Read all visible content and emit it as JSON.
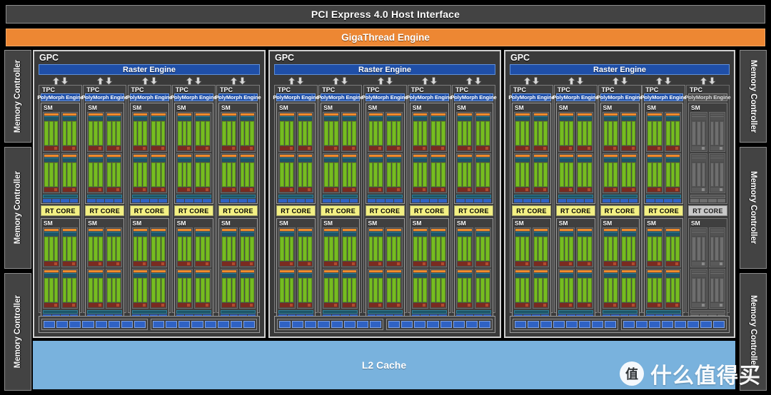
{
  "diagram": {
    "host_interface": "PCI Express 4.0 Host Interface",
    "gigathread_engine": "GigaThread Engine",
    "l2_cache": "L2 Cache",
    "gpc_label": "GPC",
    "raster_engine_label": "Raster Engine",
    "tpc_label": "TPC",
    "polymorph_label": "PolyMorph Engine",
    "sm_label": "SM",
    "rt_core_label": "RT CORE",
    "memory_controller_label": "Memory Controller"
  },
  "colors": {
    "background": "#000000",
    "panel": "#434343",
    "gpc_fill": "#3a3a3a",
    "gigathread": "#ed8733",
    "raster_blue": "#1f4fa8",
    "core_green": "#76bc21",
    "rt_core_yellow": "#f3f083",
    "l2_blue": "#79b2dd",
    "rop_blue": "#2f62c4",
    "teal": "#1d5566",
    "orange_bar": "#ef8a2b",
    "dark_red": "#7a2b20",
    "disabled_grey": "#6e6e6e"
  },
  "structure": {
    "gpc_count": 3,
    "tpc_per_gpc": 5,
    "sm_per_tpc": 2,
    "quads_per_sm": 4,
    "cores_per_quad": 3,
    "rop_groups_per_gpc": 2,
    "rops_per_group": 8,
    "memory_controllers_per_side": 3,
    "disabled_tpc_location": "gpc-3-tpc-5"
  },
  "memory_controllers": {
    "left": [
      "Memory Controller",
      "Memory Controller",
      "Memory Controller"
    ],
    "right": [
      "Memory Controller",
      "Memory Controller",
      "Memory Controller"
    ]
  },
  "gpcs": [
    {
      "label": "GPC",
      "raster": "Raster Engine",
      "tpcs": [
        {
          "label": "TPC",
          "polymorph": "PolyMorph Engine",
          "disabled": false
        },
        {
          "label": "TPC",
          "polymorph": "PolyMorph Engine",
          "disabled": false
        },
        {
          "label": "TPC",
          "polymorph": "PolyMorph Engine",
          "disabled": false
        },
        {
          "label": "TPC",
          "polymorph": "PolyMorph Engine",
          "disabled": false
        },
        {
          "label": "TPC",
          "polymorph": "PolyMorph Engine",
          "disabled": false
        }
      ]
    },
    {
      "label": "GPC",
      "raster": "Raster Engine",
      "tpcs": [
        {
          "label": "TPC",
          "polymorph": "PolyMorph Engine",
          "disabled": false
        },
        {
          "label": "TPC",
          "polymorph": "PolyMorph Engine",
          "disabled": false
        },
        {
          "label": "TPC",
          "polymorph": "PolyMorph Engine",
          "disabled": false
        },
        {
          "label": "TPC",
          "polymorph": "PolyMorph Engine",
          "disabled": false
        },
        {
          "label": "TPC",
          "polymorph": "PolyMorph Engine",
          "disabled": false
        }
      ]
    },
    {
      "label": "GPC",
      "raster": "Raster Engine",
      "tpcs": [
        {
          "label": "TPC",
          "polymorph": "PolyMorph Engine",
          "disabled": false
        },
        {
          "label": "TPC",
          "polymorph": "PolyMorph Engine",
          "disabled": false
        },
        {
          "label": "TPC",
          "polymorph": "PolyMorph Engine",
          "disabled": false
        },
        {
          "label": "TPC",
          "polymorph": "PolyMorph Engine",
          "disabled": false
        },
        {
          "label": "TPC",
          "polymorph": "PolyMorph Engine",
          "disabled": true
        }
      ]
    }
  ],
  "watermark": {
    "badge": "值",
    "text": "什么值得买"
  }
}
